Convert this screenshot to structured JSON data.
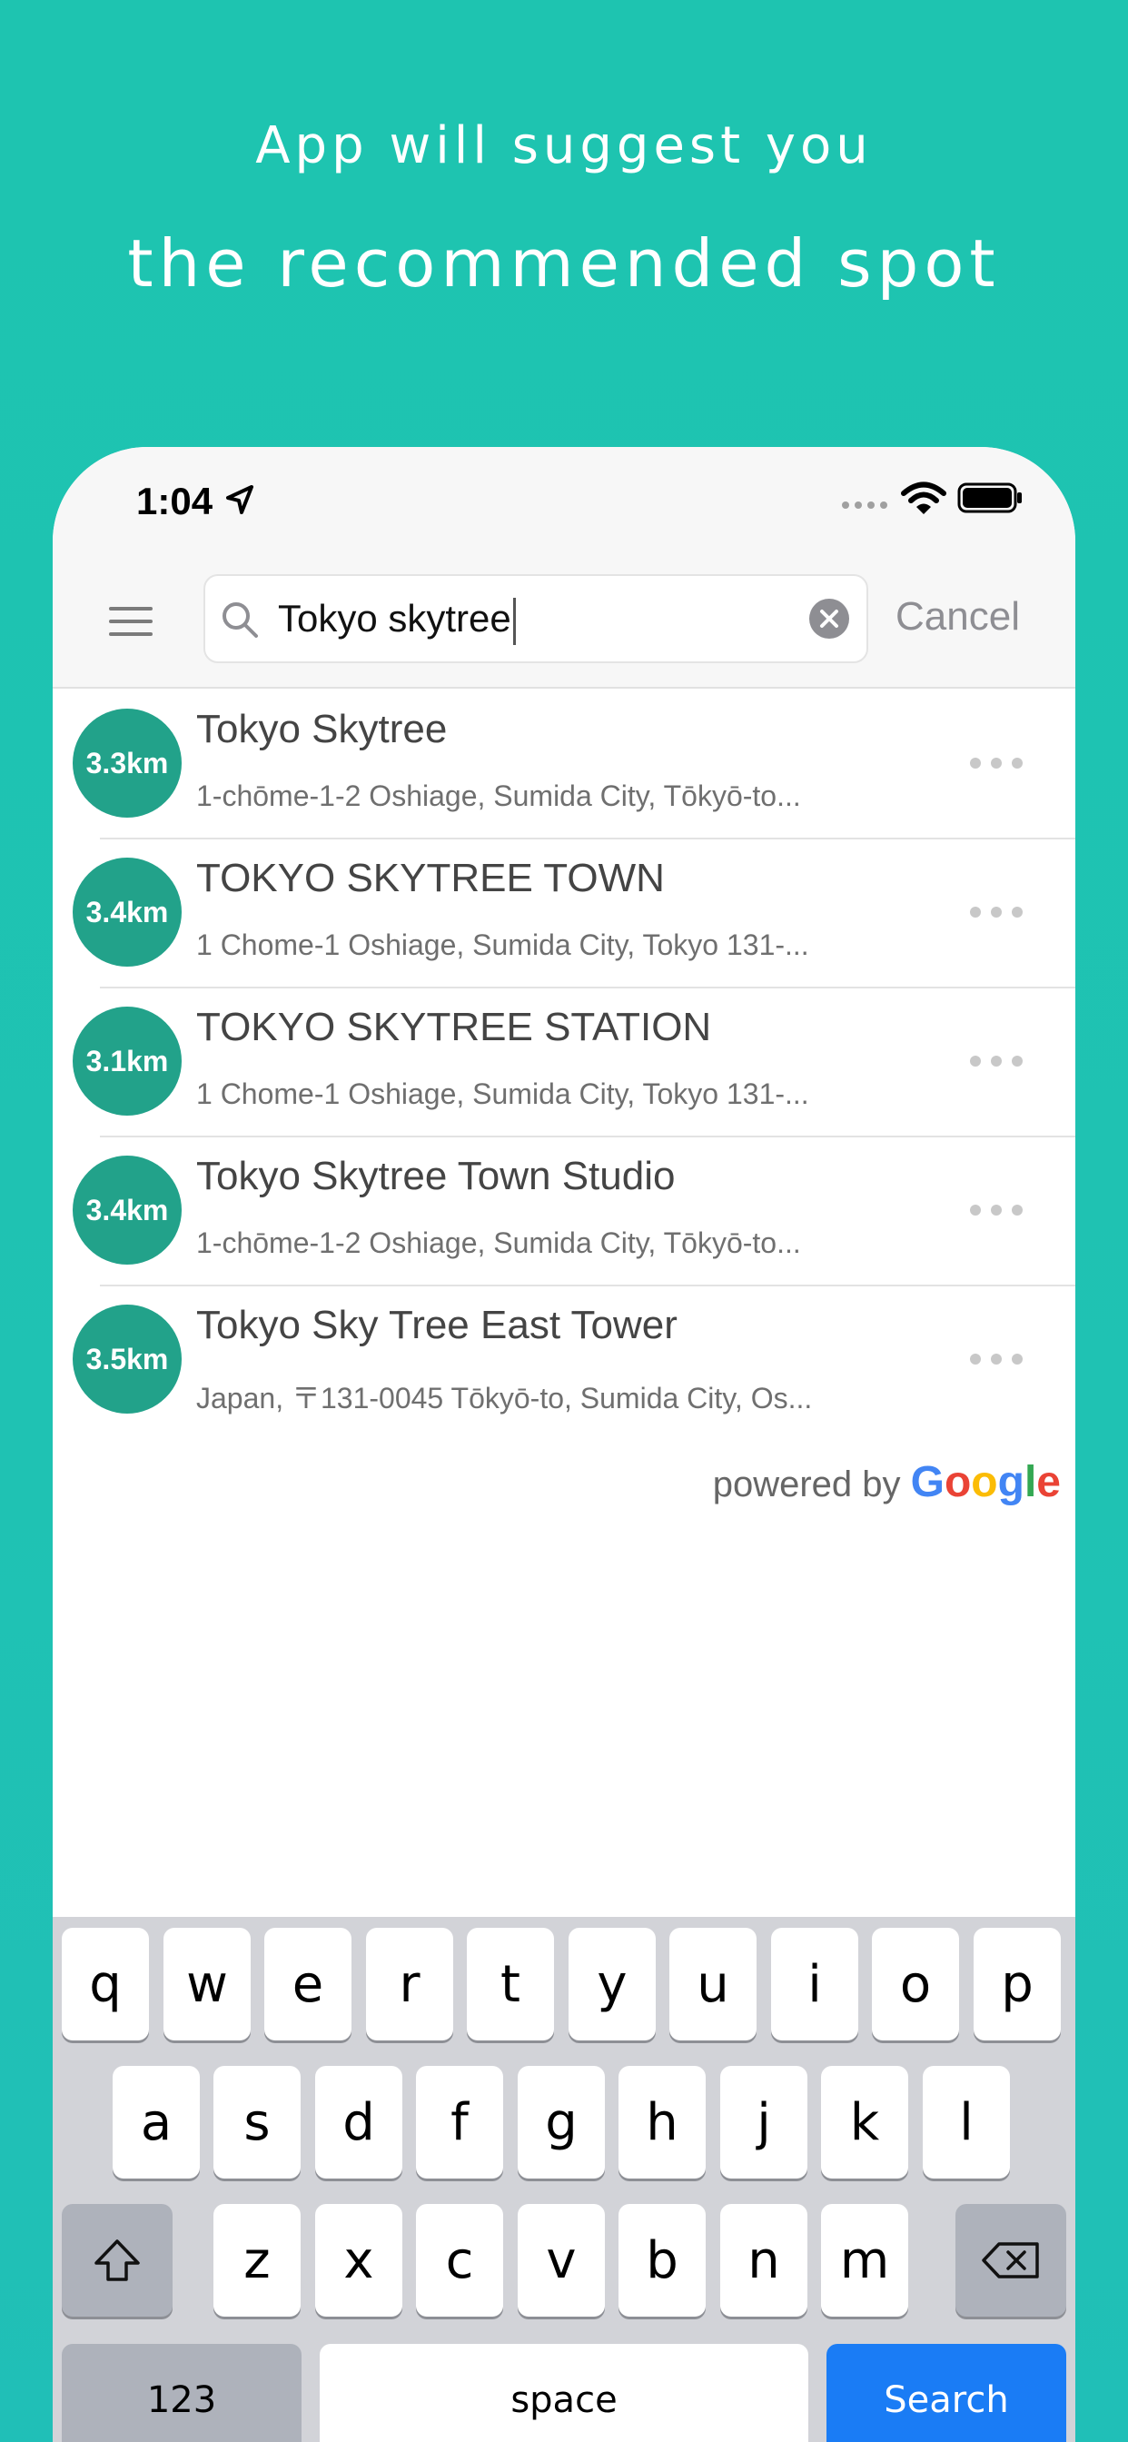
{
  "headline": {
    "line1": "App will suggest you",
    "line2": "the recommended spot"
  },
  "status_bar": {
    "time": "1:04"
  },
  "search": {
    "query": "Tokyo skytree",
    "cancel_label": "Cancel"
  },
  "results": [
    {
      "distance": "3.3km",
      "title": "Tokyo Skytree",
      "address": "1-chōme-1-2 Oshiage, Sumida City, Tōkyō-to..."
    },
    {
      "distance": "3.4km",
      "title": "TOKYO SKYTREE TOWN",
      "address": "1 Chome-1 Oshiage, Sumida City, Tokyo 131-..."
    },
    {
      "distance": "3.1km",
      "title": "TOKYO SKYTREE STATION",
      "address": "1 Chome-1 Oshiage, Sumida City, Tokyo 131-..."
    },
    {
      "distance": "3.4km",
      "title": "Tokyo Skytree Town Studio",
      "address": "1-chōme-1-2 Oshiage, Sumida City, Tōkyō-to..."
    },
    {
      "distance": "3.5km",
      "title": "Tokyo Sky Tree East Tower",
      "address": "Japan, 〒131-0045 Tōkyō-to, Sumida City, Os..."
    }
  ],
  "attribution": {
    "prefix": "powered by",
    "logo_letters": [
      {
        "char": "G",
        "color": "#4285F4"
      },
      {
        "char": "o",
        "color": "#EA4335"
      },
      {
        "char": "o",
        "color": "#FBBC05"
      },
      {
        "char": "g",
        "color": "#4285F4"
      },
      {
        "char": "l",
        "color": "#34A853"
      },
      {
        "char": "e",
        "color": "#EA4335"
      }
    ]
  },
  "keyboard": {
    "row1": [
      "q",
      "w",
      "e",
      "r",
      "t",
      "y",
      "u",
      "i",
      "o",
      "p"
    ],
    "row2": [
      "a",
      "s",
      "d",
      "f",
      "g",
      "h",
      "j",
      "k",
      "l"
    ],
    "row3": [
      "z",
      "x",
      "c",
      "v",
      "b",
      "n",
      "m"
    ],
    "numbers_label": "123",
    "space_label": "space",
    "search_label": "Search"
  },
  "colors": {
    "background": "#1ec4b0",
    "distance_badge": "#22a28a",
    "search_key": "#1a7cf5"
  },
  "icons": [
    "location-arrow-icon",
    "signal-dots-icon",
    "wifi-icon",
    "battery-icon",
    "menu-icon",
    "search-icon",
    "clear-icon",
    "more-icon",
    "shift-icon",
    "backspace-icon"
  ]
}
